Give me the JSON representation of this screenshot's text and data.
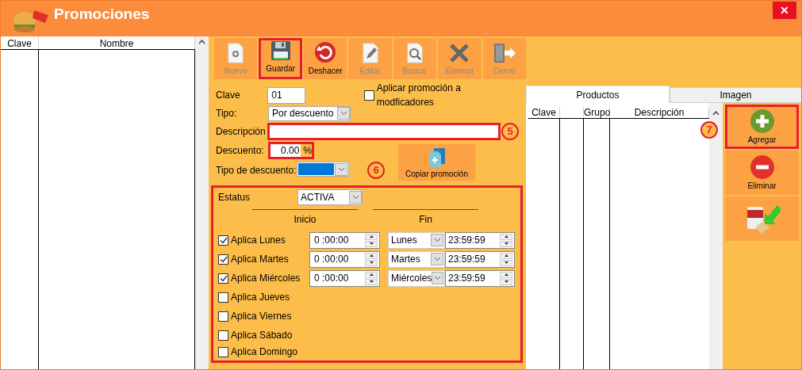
{
  "window": {
    "title": "Promociones",
    "close": "✕"
  },
  "left_table": {
    "columns": [
      "Clave",
      "Nombre"
    ]
  },
  "toolbar": [
    {
      "kind": "new",
      "label": "Nuevo",
      "disabled": true,
      "highlighted": false
    },
    {
      "kind": "save",
      "label": "Guardar",
      "disabled": false,
      "highlighted": true
    },
    {
      "kind": "undo",
      "label": "Deshacer",
      "disabled": false,
      "highlighted": false
    },
    {
      "kind": "edit",
      "label": "Editar",
      "disabled": true,
      "highlighted": false
    },
    {
      "kind": "search",
      "label": "Buscar",
      "disabled": true,
      "highlighted": false
    },
    {
      "kind": "delete",
      "label": "Eliminar",
      "disabled": true,
      "highlighted": false
    },
    {
      "kind": "close",
      "label": "Cerrar",
      "disabled": true,
      "highlighted": false
    }
  ],
  "form": {
    "clave": {
      "label": "Clave",
      "value": "01"
    },
    "modifiers": {
      "label": "Aplicar promoción a modficadores",
      "checked": false
    },
    "tipo": {
      "label": "Tipo:",
      "value": "Por descuento"
    },
    "descripcion": {
      "label": "Descripción",
      "highlighted": true,
      "callout": "5"
    },
    "descuento": {
      "label": "Descuento:",
      "value": "0.00",
      "unit": "%",
      "highlighted": true
    },
    "tipo_descuento": {
      "label": "Tipo de descuento:",
      "color": "#0078d7"
    },
    "copy_button": {
      "label": "Copiar promoción"
    },
    "callout": "6"
  },
  "schedule": {
    "highlighted": true,
    "estatus": {
      "label": "Estatus",
      "value": "ACTIVA"
    },
    "start_heading": "Inicio",
    "end_heading": "Fin",
    "days": [
      {
        "label": "Aplica Lunes",
        "checked": true,
        "start": "0 :00:00",
        "end_day": "Lunes",
        "end_time": "23:59:59"
      },
      {
        "label": "Aplica Martes",
        "checked": true,
        "start": "0 :00:00",
        "end_day": "Martes",
        "end_time": "23:59:59"
      },
      {
        "label": "Aplica Miércoles",
        "checked": true,
        "start": "0 :00:00",
        "end_day": "Miércoles",
        "end_time": "23:59:59"
      },
      {
        "label": "Aplica Jueves",
        "checked": false
      },
      {
        "label": "Aplica Viernes",
        "checked": false
      },
      {
        "label": "Aplica Sábado",
        "checked": false
      },
      {
        "label": "Aplica Domingo",
        "checked": false
      }
    ]
  },
  "tabs": [
    {
      "label": "Productos",
      "selected": true
    },
    {
      "label": "Imagen",
      "selected": false
    }
  ],
  "products_table": {
    "columns": [
      "Clave",
      "Grupo",
      "Descripción"
    ]
  },
  "side_buttons": [
    {
      "kind": "add",
      "label": "Agregar",
      "highlighted": true,
      "callout": "7"
    },
    {
      "kind": "remove",
      "label": "Eliminar",
      "highlighted": false
    },
    {
      "kind": "import",
      "highlighted": false
    }
  ]
}
